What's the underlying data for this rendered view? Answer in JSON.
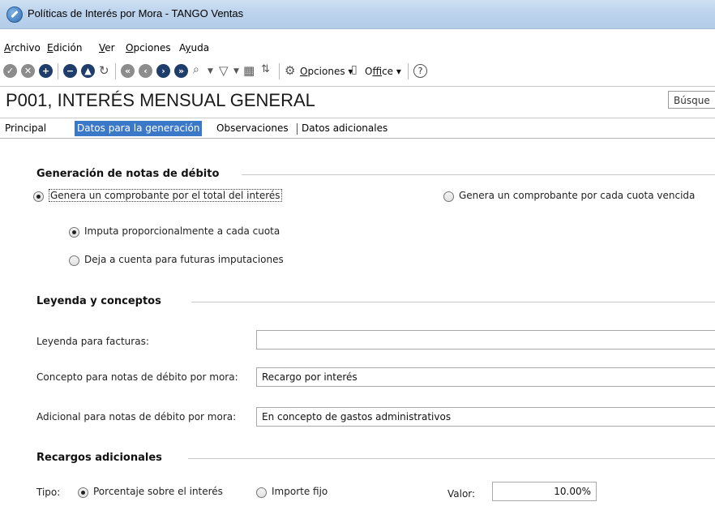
{
  "window": {
    "title": "Políticas de Interés por Mora - TANGO Ventas"
  },
  "menu": [
    {
      "label": "Archivo",
      "mnemonic": "A",
      "rest": "rchivo"
    },
    {
      "label": "Edición",
      "mnemonic": "E",
      "rest": "dición"
    },
    {
      "label": "Ver",
      "mnemonic": "V",
      "rest": "er"
    },
    {
      "label": "Opciones",
      "mnemonic": "O",
      "rest": "pciones"
    },
    {
      "label": "Ayuda",
      "pre": "A",
      "mnemonic": "y",
      "rest": "uda"
    }
  ],
  "toolbar": {
    "opciones_mnemonic": "O",
    "opciones_rest": "pciones",
    "office_pre": "O",
    "office_mnemonic": "f",
    "office_rest": "fice",
    "help_glyph": "?"
  },
  "header": {
    "title": "P001, INTERÉS MENSUAL GENERAL",
    "search_placeholder": "Búsque"
  },
  "tabs": [
    "Principal",
    "Datos para la generación",
    "Observaciones",
    "Datos adicionales"
  ],
  "active_tab": "Datos para la generación",
  "generacion": {
    "title": "Generación de notas de débito",
    "opt_total": "Genera un comprobante por el total del interés",
    "opt_cuota": "Genera un comprobante por cada cuota vencida",
    "sub_imputa": "Imputa proporcionalmente a cada cuota",
    "sub_deja": "Deja a cuenta para futuras imputaciones"
  },
  "leyenda": {
    "title": "Leyenda y conceptos",
    "facturas_label": "Leyenda para facturas:",
    "facturas_value": "",
    "concepto_label": "Concepto para notas de débito por mora:",
    "concepto_value": "Recargo por interés",
    "adicional_label": "Adicional para notas de débito por mora:",
    "adicional_value": "En concepto de gastos administrativos"
  },
  "recargos": {
    "title": "Recargos adicionales",
    "tipo_label": "Tipo:",
    "opt_porcentaje": "Porcentaje sobre el interés",
    "opt_importe": "Importe fijo",
    "valor_label": "Valor:",
    "valor_value": "10.00%"
  },
  "colors": {
    "active_tab": "#3c78c8",
    "toolbar_dark": "#1f3d6b",
    "toolbar_grey": "#8c8c8c"
  }
}
